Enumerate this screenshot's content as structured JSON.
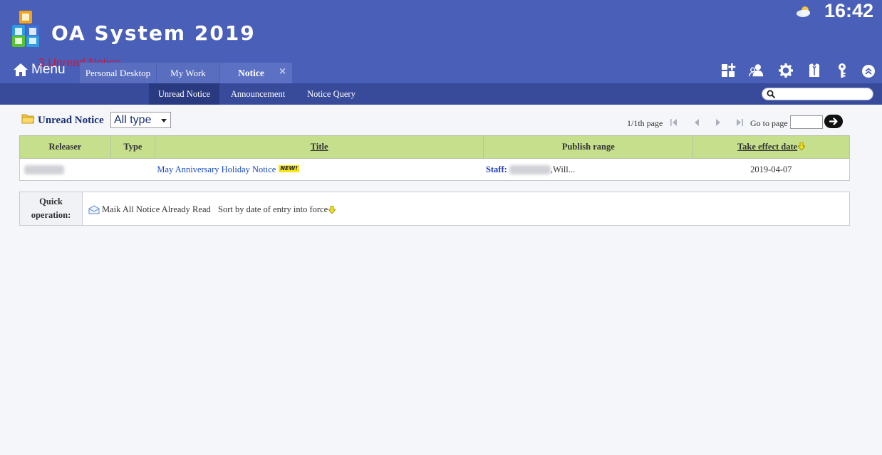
{
  "header": {
    "app_title": "OA System 2019",
    "clock": "16:42",
    "menu_label": "Menu",
    "overlay_label": "3.Unread Notice",
    "tabs": [
      {
        "label": "Personal Desktop"
      },
      {
        "label": "My Work"
      },
      {
        "label": "Notice",
        "close": "×"
      }
    ],
    "toolbar_icons": [
      "grid-plus-icon",
      "user-group-icon",
      "gear-icon",
      "shirt-icon",
      "key-icon",
      "chevron-up-icon"
    ]
  },
  "subnav": {
    "items": [
      {
        "label": "Unread Notice"
      },
      {
        "label": "Announcement"
      },
      {
        "label": "Notice Query"
      }
    ],
    "search_placeholder": ""
  },
  "toolbar": {
    "heading": "Unread Notice",
    "type_filter": "All type",
    "pager_info": "1/1th page",
    "goto_label": "Go to page",
    "goto_value": ""
  },
  "table": {
    "columns": [
      "Releaser",
      "Type",
      "Title",
      "Publish range",
      "Take effect date"
    ],
    "rows": [
      {
        "releaser": "",
        "type": "",
        "title": "May Anniversary Holiday Notice",
        "badge": "NEW!",
        "staff_label": "Staff:",
        "range_suffix": ",Will...",
        "date": "2019-04-07"
      }
    ]
  },
  "quick": {
    "label_line1": "Quick",
    "label_line2": "operation:",
    "mark_all": "Maik All Notice Already Read",
    "sort_label": "Sort by date of entry into force"
  },
  "colors": {
    "header_bg": "#4a5fb8",
    "subnav_bg": "#384a9a",
    "table_header_bg": "#c5df8c",
    "link": "#1a4bb8",
    "overlay": "#e0102a"
  }
}
